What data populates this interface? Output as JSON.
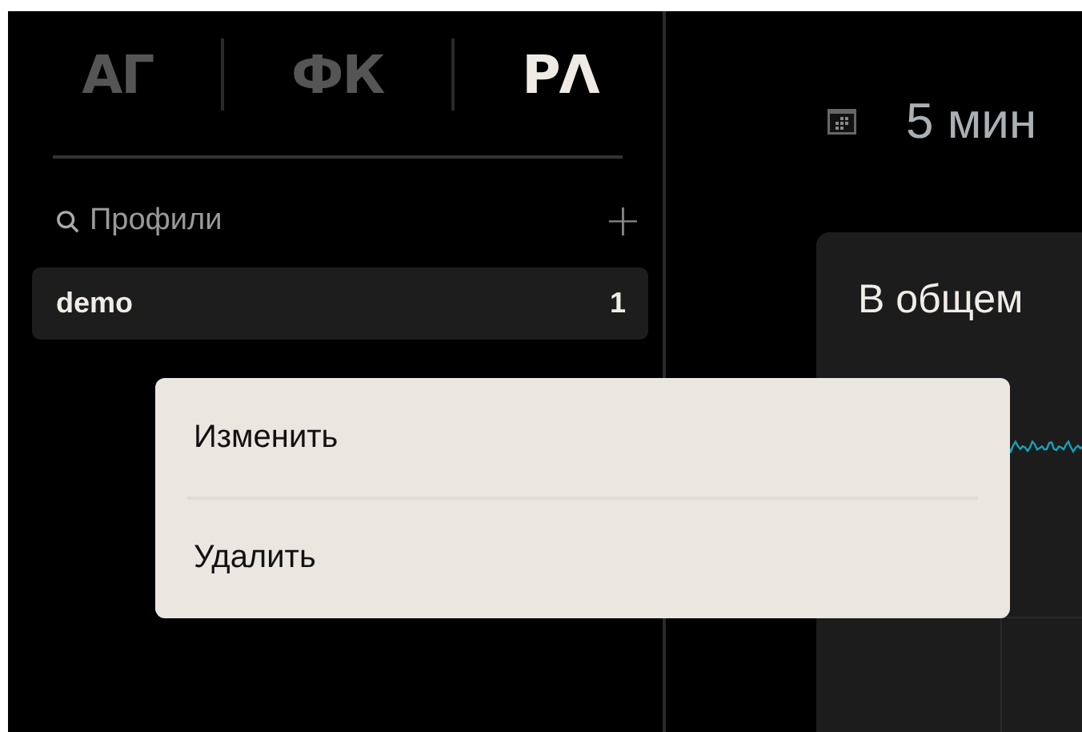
{
  "brand_tabs": [
    {
      "label": "АГ",
      "selected": false
    },
    {
      "label": "ФК",
      "selected": false
    },
    {
      "label": "РΛ",
      "selected": true
    }
  ],
  "profiles": {
    "search_placeholder": "Профили",
    "add_label": "+",
    "items": [
      {
        "name": "demo",
        "count": "1",
        "selected": true
      }
    ]
  },
  "context_menu": {
    "items": [
      "Изменить",
      "Удалить"
    ]
  },
  "time_range": {
    "label": "5 мин"
  },
  "card": {
    "title": "В общем"
  }
}
